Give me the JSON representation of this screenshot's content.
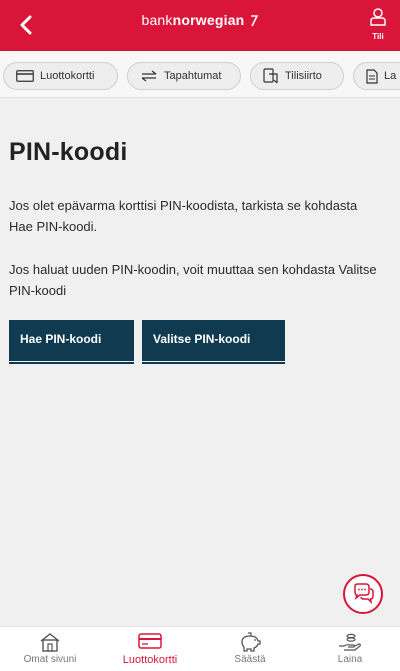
{
  "header": {
    "logo_part1": "bank",
    "logo_part2": "norwegian",
    "account_label": "Tili",
    "colors": {
      "brand_red": "#d9163a"
    }
  },
  "tabs": [
    {
      "label": "Luottokortti",
      "icon": "credit-card-icon"
    },
    {
      "label": "Tapahtumat",
      "icon": "transactions-arrows-icon"
    },
    {
      "label": "Tilisiirto",
      "icon": "transfer-icon"
    },
    {
      "label": "La",
      "icon": "document-icon"
    }
  ],
  "main": {
    "title": "PIN-koodi",
    "paragraph1": "Jos olet epävarma korttisi PIN-koodista, tarkista se kohdasta Hae PIN-koodi.",
    "paragraph2": "Jos haluat uuden PIN-koodin, voit muuttaa sen kohdasta Valitse PIN-koodi",
    "button_get_pin": "Hae PIN-koodi",
    "button_choose_pin": "Valitse PIN-koodi",
    "button_color": "#0f3a4f"
  },
  "bottom_nav": [
    {
      "label": "Omat sivuni",
      "icon": "home-icon",
      "active": false
    },
    {
      "label": "Luottokortti",
      "icon": "credit-card-icon",
      "active": true
    },
    {
      "label": "Säästä",
      "icon": "piggy-bank-icon",
      "active": false
    },
    {
      "label": "Laina",
      "icon": "loan-hand-icon",
      "active": false
    }
  ]
}
